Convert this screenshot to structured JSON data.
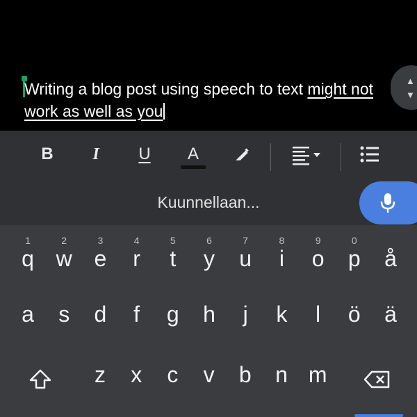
{
  "document": {
    "text_plain": "Writing a blog post using speech to text ",
    "text_underlined_1": "might not",
    "text_underlined_2": "work as well as you"
  },
  "toolbar": {
    "bold": "B",
    "italic": "I",
    "underline": "U",
    "text_color": "A",
    "text_color_bar": "#111111"
  },
  "voice": {
    "status": "Kuunnellaan..."
  },
  "keyboard": {
    "row1": [
      {
        "hint": "1",
        "key": "q"
      },
      {
        "hint": "2",
        "key": "w"
      },
      {
        "hint": "3",
        "key": "e"
      },
      {
        "hint": "4",
        "key": "r"
      },
      {
        "hint": "5",
        "key": "t"
      },
      {
        "hint": "6",
        "key": "y"
      },
      {
        "hint": "7",
        "key": "u"
      },
      {
        "hint": "8",
        "key": "i"
      },
      {
        "hint": "9",
        "key": "o"
      },
      {
        "hint": "0",
        "key": "p"
      },
      {
        "hint": "",
        "key": "å"
      }
    ],
    "row2": [
      "a",
      "s",
      "d",
      "f",
      "g",
      "h",
      "j",
      "k",
      "l",
      "ö",
      "ä"
    ],
    "row3": [
      "z",
      "x",
      "c",
      "v",
      "b",
      "n",
      "m"
    ]
  },
  "colors": {
    "accent_blue": "#4a7fe0",
    "cursor_green": "#1aa260"
  }
}
